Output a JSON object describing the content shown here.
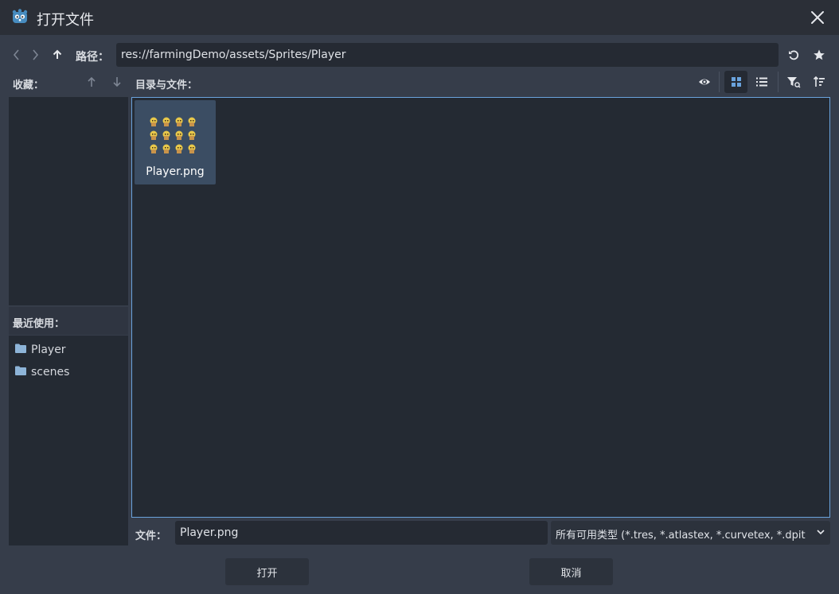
{
  "window": {
    "title": "打开文件"
  },
  "toolbar": {
    "path_label": "路径：",
    "path_value": "res://farmingDemo/assets/Sprites/Player"
  },
  "favorites": {
    "label": "收藏："
  },
  "files_panel": {
    "label": "目录与文件：",
    "items": [
      {
        "name": "Player.png",
        "selected": true
      }
    ]
  },
  "recent": {
    "label": "最近使用：",
    "items": [
      {
        "name": "Player"
      },
      {
        "name": "scenes"
      }
    ]
  },
  "footer": {
    "file_label": "文件：",
    "file_value": "Player.png",
    "filter_value": "所有可用类型 (*.tres, *.atlastex, *.curvetex, *.dpit",
    "open_label": "打开",
    "cancel_label": "取消"
  },
  "colors": {
    "accent": "#6aa3dd",
    "selection": "#3b4d63",
    "background": "#363d4a",
    "panel": "#242a33",
    "folder": "#8db4d8"
  },
  "icons": [
    "godot-icon",
    "close-icon",
    "back-icon",
    "forward-icon",
    "up-icon",
    "refresh-icon",
    "star-icon",
    "move-up-icon",
    "move-down-icon",
    "eye-icon",
    "grid-view-icon",
    "list-view-icon",
    "filter-icon",
    "sort-icon",
    "folder-icon",
    "chevron-down-icon"
  ]
}
